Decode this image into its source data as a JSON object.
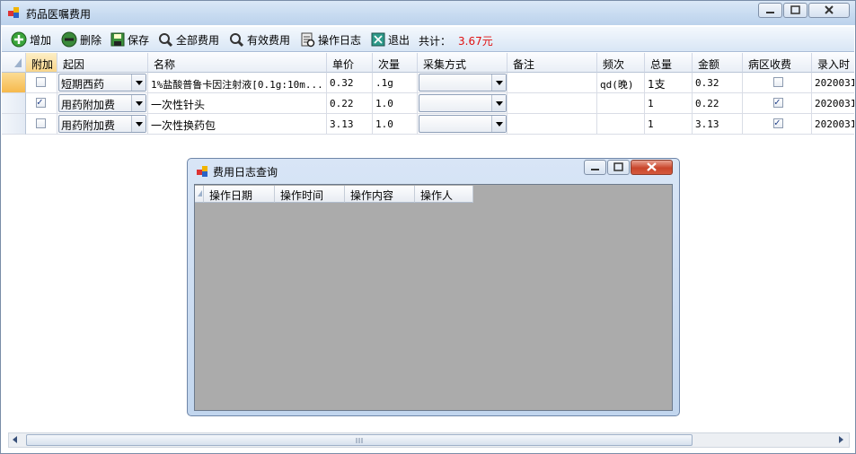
{
  "window": {
    "title": "药品医嘱费用"
  },
  "toolbar": {
    "add": "增加",
    "delete": "删除",
    "save": "保存",
    "all_fees": "全部费用",
    "valid_fees": "有效费用",
    "op_log": "操作日志",
    "exit": "退出",
    "total_label": "共计：",
    "total_value": "3.67元"
  },
  "grid": {
    "columns": [
      "附加",
      "起因",
      "名称",
      "单价",
      "次量",
      "采集方式",
      "备注",
      "频次",
      "总量",
      "金额",
      "病区收费",
      "录入时"
    ],
    "rows": [
      {
        "attached": false,
        "cause": "短期西药",
        "name": "1%盐酸普鲁卡因注射液[0.1g:10m...",
        "unit_price": "0.32",
        "dose": ".1g",
        "collect": "",
        "note": "",
        "freq": "qd(晚)",
        "qty": "1支",
        "amount": "0.32",
        "ward_charge": false,
        "time": "2020031"
      },
      {
        "attached": true,
        "cause": "用药附加费",
        "name": "一次性针头",
        "unit_price": "0.22",
        "dose": "1.0",
        "collect": "",
        "note": "",
        "freq": "",
        "qty": "1",
        "amount": "0.22",
        "ward_charge": true,
        "time": "2020031"
      },
      {
        "attached": false,
        "cause": "用药附加费",
        "name": "一次性换药包",
        "unit_price": "3.13",
        "dose": "1.0",
        "collect": "",
        "note": "",
        "freq": "",
        "qty": "1",
        "amount": "3.13",
        "ward_charge": true,
        "time": "2020031"
      }
    ]
  },
  "dialog": {
    "title": "费用日志查询",
    "columns": [
      "操作日期",
      "操作时间",
      "操作内容",
      "操作人"
    ]
  },
  "colors": {
    "total": "#e01010",
    "selected_row": "#f6b94c",
    "dialog_body": "#ababab"
  }
}
